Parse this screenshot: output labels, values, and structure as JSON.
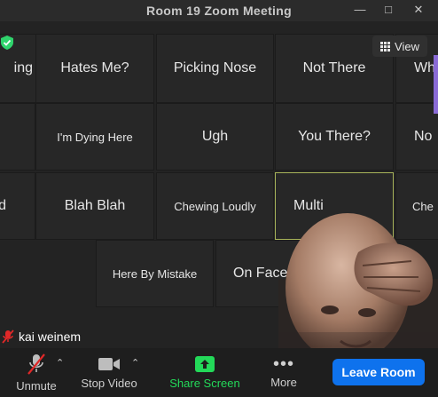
{
  "window": {
    "title": "Room 19  Zoom Meeting",
    "controls": [
      "minimize-icon",
      "maximize-icon",
      "close-icon"
    ]
  },
  "gallery": {
    "view_label": "View",
    "tiles": [
      "ing",
      "Hates Me?",
      "Picking Nose",
      "Not There",
      "Wh",
      "I'm Dying Here",
      "Ugh",
      "You There?",
      "No",
      "d",
      "Blah Blah",
      "Chewing Loudly",
      "Multi",
      "Che",
      "Here By Mistake",
      "On Face"
    ]
  },
  "self_view": {
    "name": "kai weinem",
    "mic_status": "muted-mic-icon"
  },
  "toolbar": {
    "unmute": "Unmute",
    "stop_video": "Stop Video",
    "share_screen": "Share Screen",
    "more": "More",
    "leave": "Leave Room"
  },
  "colors": {
    "share_green": "#23d959",
    "leave_blue": "#0e72ed",
    "mute_red": "#e02828",
    "shield_green": "#2fd46c",
    "active_tile_border": "#a8b45a"
  }
}
